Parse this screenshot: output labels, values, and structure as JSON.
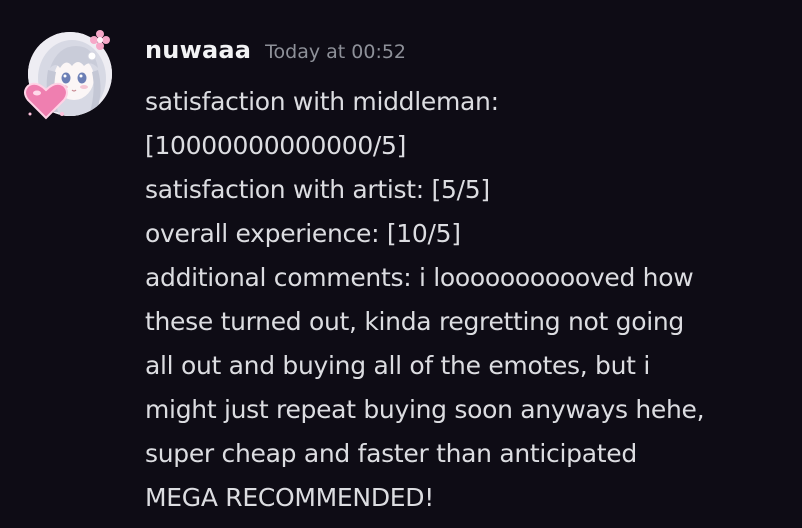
{
  "message": {
    "author": "nuwaaa",
    "timestamp": "Today at 00:52",
    "lines": [
      "satisfaction with middleman:",
      "[10000000000000/5]",
      "satisfaction with artist: [5/5]",
      "overall experience: [10/5]",
      "additional comments: i looooooooooved how",
      "these turned out, kinda regretting not going",
      "all out and buying all of the emotes, but i",
      "might just repeat buying soon anyways hehe,",
      "super cheap and faster than anticipated",
      "MEGA RECOMMENDED!"
    ]
  },
  "colors": {
    "background": "#0e0c15",
    "username": "#f2f3f5",
    "timestamp": "#8e9199",
    "text": "#dcdde1"
  }
}
